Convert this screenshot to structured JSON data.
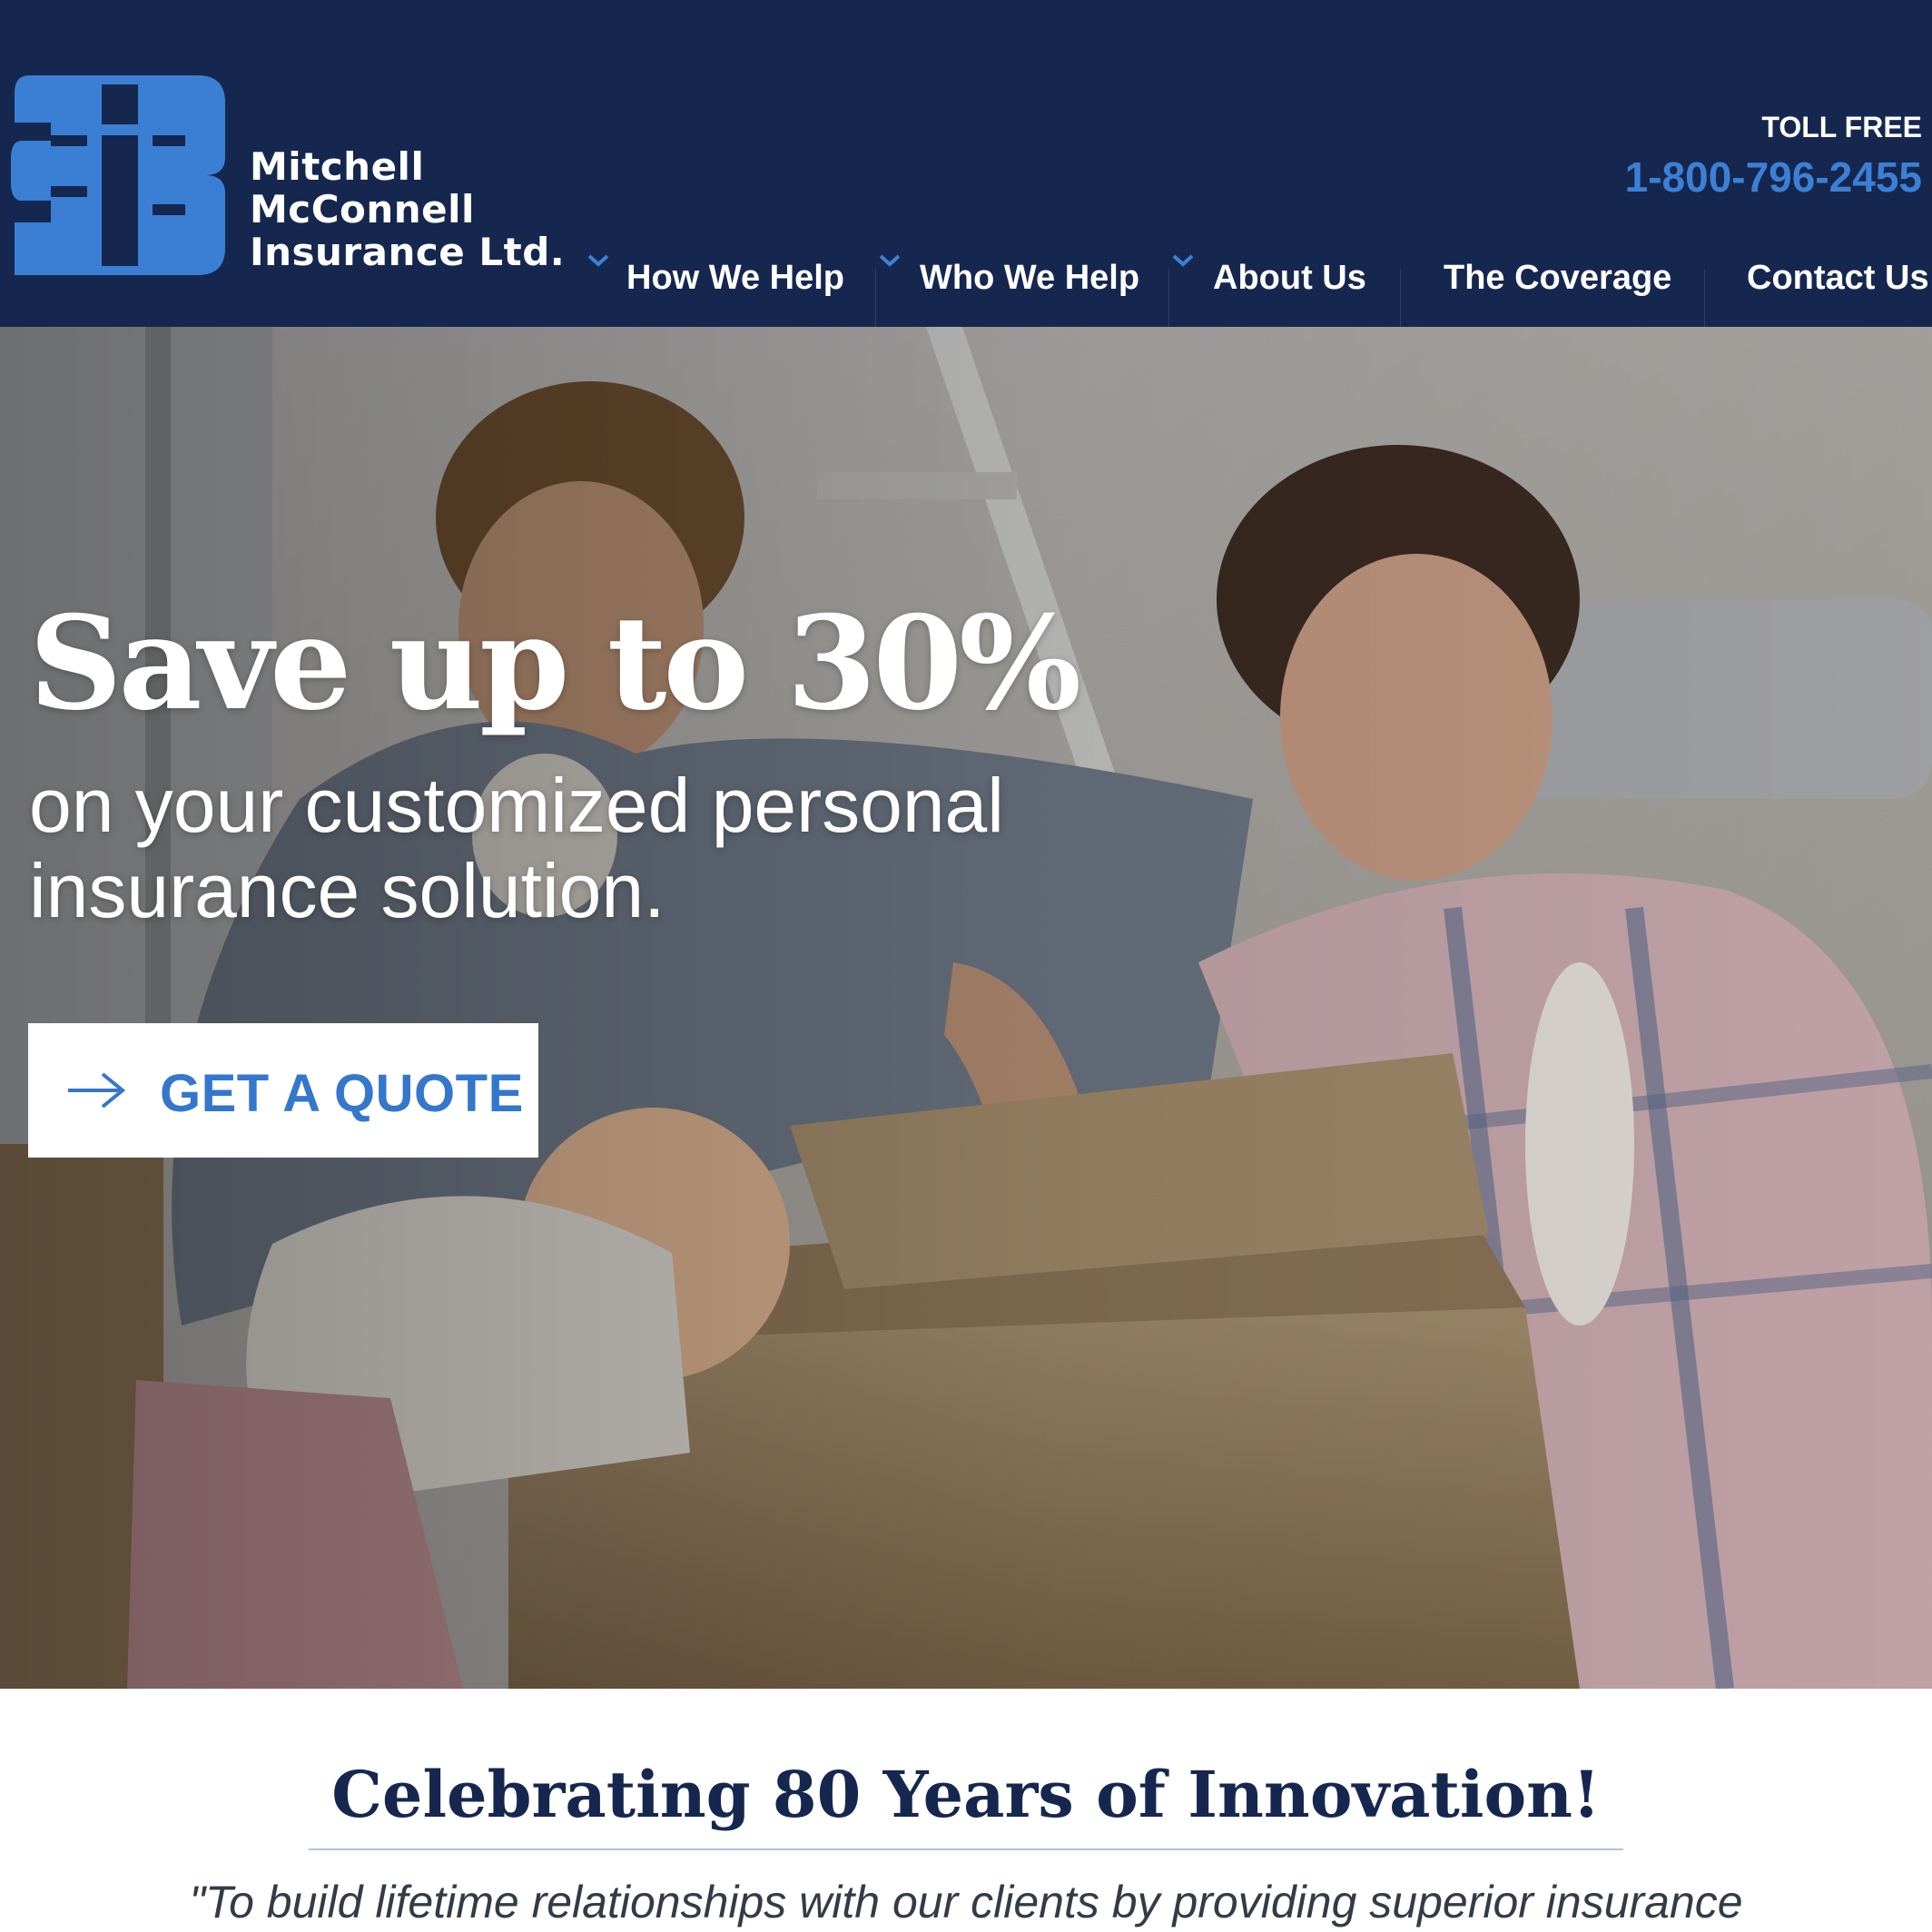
{
  "header": {
    "logo": {
      "line1": "Mitchell",
      "line2": "McConnell",
      "line3": "Insurance Ltd."
    },
    "toll_free_label": "TOLL FREE",
    "toll_free_number": "1-800-796-2455",
    "nav": [
      {
        "label": "How We Help",
        "has_dropdown": true
      },
      {
        "label": "Who We Help",
        "has_dropdown": true
      },
      {
        "label": "About Us",
        "has_dropdown": true
      },
      {
        "label": "The Coverage",
        "has_dropdown": false
      },
      {
        "label": "Contact Us",
        "has_dropdown": false
      }
    ]
  },
  "hero": {
    "headline": "Save up to 30%",
    "subheadline": "on your customized personal insurance solution.",
    "cta_label": "GET A QUOTE",
    "cta_icon": "arrow-right-icon"
  },
  "intro": {
    "title": "Celebrating 80 Years of Innovation!",
    "quote": "\"To build lifetime relationships with our clients by providing superior insurance"
  },
  "colors": {
    "header_bg": "#16274f",
    "accent_blue": "#3c80d6",
    "logo_blue": "#3a7fd4",
    "title_navy": "#16274f",
    "white": "#ffffff"
  }
}
